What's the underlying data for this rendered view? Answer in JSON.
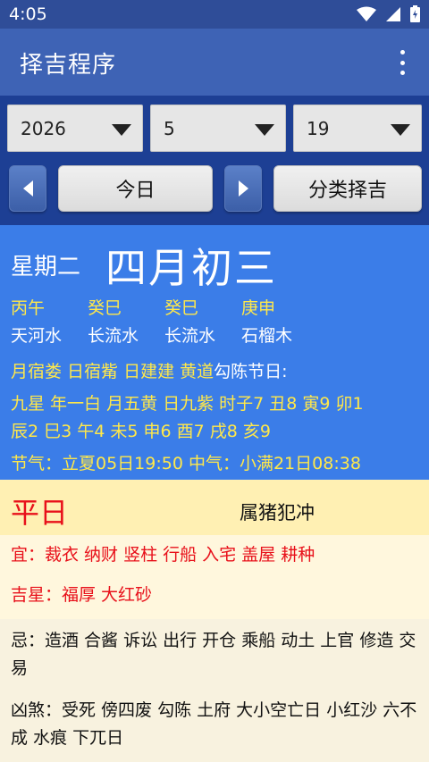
{
  "status": {
    "time": "4:05"
  },
  "appbar": {
    "title": "择吉程序"
  },
  "selectors": {
    "year": "2026",
    "month": "5",
    "day": "19"
  },
  "buttons": {
    "today": "今日",
    "category": "分类择吉"
  },
  "date": {
    "weekday": "星期二",
    "lunar": "四月初三",
    "ganzhi": [
      "丙午",
      "癸巳",
      "癸巳",
      "庚申"
    ],
    "nayin": [
      "天河水",
      "长流水",
      "长流水",
      "石榴木"
    ],
    "line_sx": {
      "part1": "月宿娄 日宿觜 日建建 黄道",
      "part2": "勾陈",
      "part3": " 节日:"
    },
    "jiuxing_1": "九星    年一白 月五黄 日九紫 时子7 丑8 寅9 卯1",
    "jiuxing_2": "辰2 巳3 午4 未5 申6 酉7 戌8 亥9",
    "jieqi": "节气：立夏05日19:50   中气：小满21日08:38"
  },
  "day_info": {
    "type": "平日",
    "chong": "属猪犯冲",
    "yi": "宜：裁衣 纳财 竖柱 行船 入宅 盖屋 耕种",
    "jixing": "吉星：福厚 大红砂",
    "ji": "忌：造酒 合酱 诉讼 出行 开仓 乘船 动土 上官 修造 交易",
    "xiongsha": "凶煞：受死 傍四废 勾陈 土府 大小空亡日 小红沙 六不成 水痕 下兀日"
  }
}
